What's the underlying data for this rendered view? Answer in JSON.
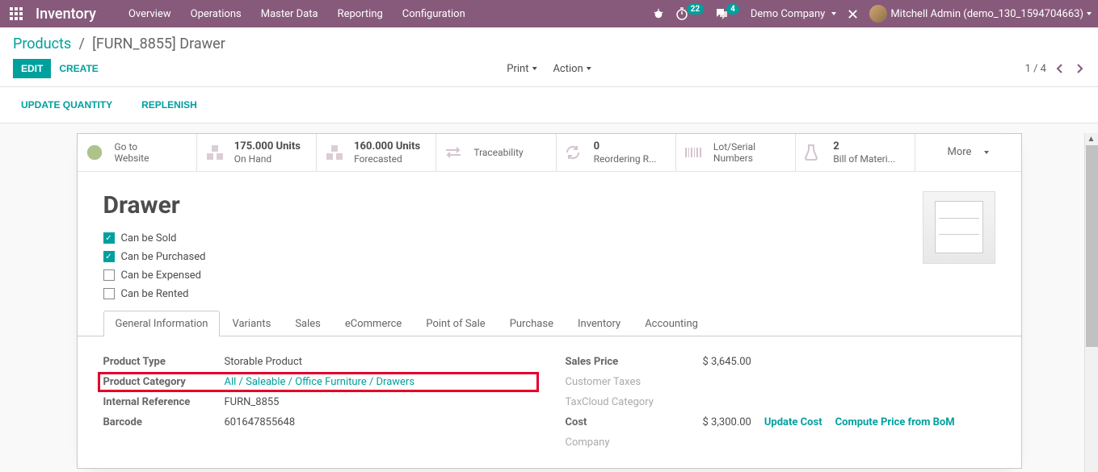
{
  "navbar": {
    "app_title": "Inventory",
    "menu": [
      "Overview",
      "Operations",
      "Master Data",
      "Reporting",
      "Configuration"
    ],
    "timer_badge": "22",
    "chat_badge": "4",
    "company": "Demo Company",
    "user": "Mitchell Admin (demo_130_1594704663)"
  },
  "breadcrumb": {
    "parent": "Products",
    "current": "[FURN_8855] Drawer"
  },
  "actions": {
    "edit": "EDIT",
    "create": "CREATE",
    "print": "Print",
    "action": "Action",
    "pager": "1 / 4",
    "update_qty": "UPDATE QUANTITY",
    "replenish": "REPLENISH"
  },
  "stats": {
    "website": {
      "label": "Go to",
      "value": "Website"
    },
    "onhand": {
      "value": "175.000 Units",
      "label": "On Hand"
    },
    "forecast": {
      "value": "160.000 Units",
      "label": "Forecasted"
    },
    "trace": {
      "label": "Traceability"
    },
    "reorder": {
      "value": "0",
      "label": "Reordering R..."
    },
    "lot": {
      "label": "Lot/Serial",
      "value": "Numbers"
    },
    "bom": {
      "value": "2",
      "label": "Bill of Materi..."
    },
    "more": "More"
  },
  "product": {
    "name": "Drawer",
    "can_sold": "Can be Sold",
    "can_purchased": "Can be Purchased",
    "can_expensed": "Can be Expensed",
    "can_rented": "Can be Rented"
  },
  "tabs": [
    "General Information",
    "Variants",
    "Sales",
    "eCommerce",
    "Point of Sale",
    "Purchase",
    "Inventory",
    "Accounting"
  ],
  "fields": {
    "product_type": {
      "label": "Product Type",
      "value": "Storable Product"
    },
    "product_category": {
      "label": "Product Category",
      "value": "All / Saleable / Office Furniture / Drawers"
    },
    "internal_ref": {
      "label": "Internal Reference",
      "value": "FURN_8855"
    },
    "barcode": {
      "label": "Barcode",
      "value": "601647855648"
    },
    "sales_price": {
      "label": "Sales Price",
      "value": "$ 3,645.00"
    },
    "customer_taxes": {
      "label": "Customer Taxes",
      "value": ""
    },
    "taxcloud": {
      "label": "TaxCloud Category",
      "value": ""
    },
    "cost": {
      "label": "Cost",
      "value": "$ 3,300.00",
      "update": "Update Cost",
      "compute": "Compute Price from BoM"
    },
    "company": {
      "label": "Company",
      "value": ""
    }
  }
}
